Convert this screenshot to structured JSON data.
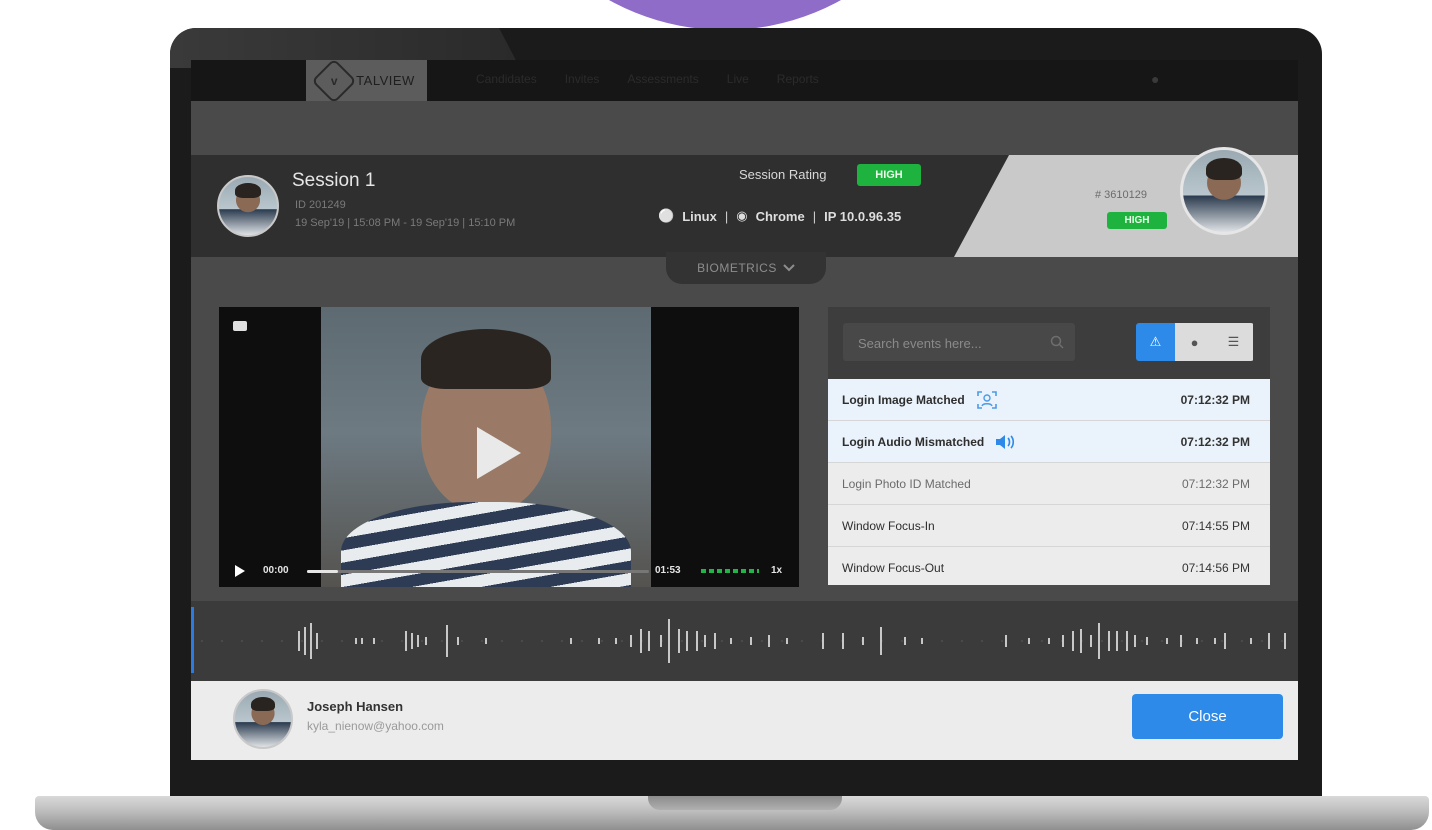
{
  "app": {
    "brand": "TALVIEW",
    "nav_items": [
      "Candidates",
      "Invites",
      "Assessments",
      "Live",
      "Reports"
    ]
  },
  "session": {
    "title": "Session 1",
    "id_text": "ID 201249",
    "time_range": "19 Sep'19 | 15:08 PM - 19 Sep'19 | 15:10 PM",
    "rating_label": "Session Rating",
    "rating_value": "HIGH",
    "os": "Linux",
    "browser": "Chrome",
    "ip": "IP 10.0.96.35"
  },
  "candidate": {
    "id": "# 3610129",
    "rating": "HIGH"
  },
  "biometrics_label": "BIOMETRICS",
  "video": {
    "current_time": "00:00",
    "duration": "01:53",
    "speed": "1x",
    "progress_fraction": 0.09
  },
  "events": {
    "search_placeholder": "Search events here...",
    "filters": [
      "warning-icon",
      "info-icon",
      "list-icon"
    ],
    "items": [
      {
        "name": "Login Image Matched",
        "time": "07:12:32 PM",
        "icon": "face-scan-icon"
      },
      {
        "name": "Login Audio Mismatched",
        "time": "07:12:32 PM",
        "icon": "speaker-icon"
      },
      {
        "name": "Login Photo ID Matched",
        "time": "07:12:32 PM",
        "icon": ""
      },
      {
        "name": "Window Focus-In",
        "time": "07:14:55 PM",
        "icon": ""
      },
      {
        "name": "Window Focus-Out",
        "time": "07:14:56 PM",
        "icon": ""
      }
    ]
  },
  "user": {
    "name": "Joseph Hansen",
    "email": "kyla_nienow@yahoo.com"
  },
  "close_label": "Close",
  "colors": {
    "accent": "#2d8ae8",
    "badge_green": "#1db33e",
    "purple": "#8e6cc8"
  }
}
